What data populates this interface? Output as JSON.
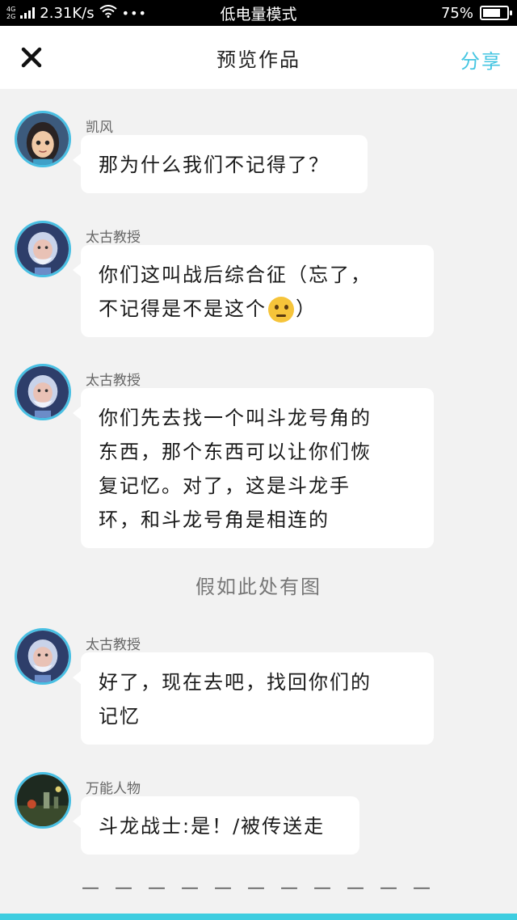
{
  "status_bar": {
    "network_tag_top": "4G",
    "network_tag_bottom": "2G",
    "speed": "2.31K/s",
    "more": "•••",
    "mode": "低电量模式",
    "battery_percent": "75%",
    "battery_level": 0.75
  },
  "nav": {
    "title": "预览作品",
    "share_label": "分享"
  },
  "messages": [
    {
      "sender": "凯风",
      "avatar": "girl-avatar",
      "lines": [
        "那为什么我们不记得了？"
      ]
    },
    {
      "sender": "太古教授",
      "avatar": "professor-avatar",
      "lines": [
        "你们这叫战后综合征（忘了，",
        "不记得是不是这个",
        "）"
      ],
      "emoji": "thinking-face-icon"
    },
    {
      "sender": "太古教授",
      "avatar": "professor-avatar",
      "lines": [
        "你们先去找一个叫斗龙号角的",
        "东西，那个东西可以让你们恢",
        "复记忆。对了，这是斗龙手",
        "环，和斗龙号角是相连的"
      ]
    },
    {
      "sender": "太古教授",
      "avatar": "professor-avatar",
      "lines": [
        "好了，现在去吧，找回你们的",
        "记忆"
      ]
    },
    {
      "sender": "万能人物",
      "avatar": "scene-avatar",
      "lines": [
        "斗龙战士:是！/被传送走"
      ]
    }
  ],
  "image_placeholder": "假如此处有图",
  "end_marker": "— — — — — — — — — — —",
  "colors": {
    "accent": "#46c6e2",
    "avatar_border": "#48bfe3",
    "background": "#f2f2f2"
  }
}
